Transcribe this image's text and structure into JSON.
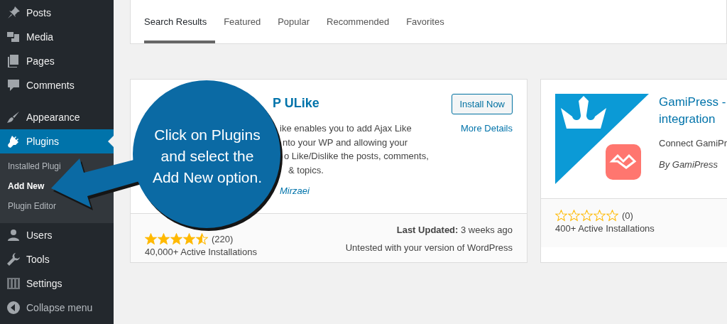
{
  "sidebar": {
    "items": [
      {
        "label": "Posts",
        "selected": false
      },
      {
        "label": "Media",
        "selected": false
      },
      {
        "label": "Pages",
        "selected": false
      },
      {
        "label": "Comments",
        "selected": false
      },
      {
        "label": "Appearance",
        "selected": false
      },
      {
        "label": "Plugins",
        "selected": true,
        "children": [
          {
            "label": "Installed Plugi",
            "selected": false
          },
          {
            "label": "Add New",
            "selected": true
          },
          {
            "label": "Plugin Editor",
            "selected": false
          }
        ]
      },
      {
        "label": "Users",
        "selected": false
      },
      {
        "label": "Tools",
        "selected": false
      },
      {
        "label": "Settings",
        "selected": false
      }
    ],
    "collapse": "Collapse menu"
  },
  "tabs": [
    {
      "label": "Search Results",
      "selected": true
    },
    {
      "label": "Featured",
      "selected": false
    },
    {
      "label": "Popular",
      "selected": false
    },
    {
      "label": "Recommended",
      "selected": false
    },
    {
      "label": "Favorites",
      "selected": false
    }
  ],
  "plugins": [
    {
      "title": "P ULike",
      "description": [
        "ike enables you to add Ajax Like",
        "nto your WP and allowing your",
        "o Like/Dislike the posts, comments,",
        "& topics."
      ],
      "author": "Mirzaei",
      "install": "Install Now",
      "details": "More Details",
      "stars": 4.5,
      "rating_count": "(220)",
      "installs": "40,000+ Active Installations",
      "updated_label": "Last Updated:",
      "updated": "3 weeks ago",
      "compat": "Untested with your version of WordPress"
    },
    {
      "title": "GamiPress - integration",
      "description": [
        "Connect GamiPr"
      ],
      "author": "By GamiPress",
      "stars": 0,
      "rating_count": "(0)",
      "installs": "400+ Active Installations"
    }
  ],
  "callout": {
    "text": "Click on Plugins\nand select the\nAdd New option."
  }
}
